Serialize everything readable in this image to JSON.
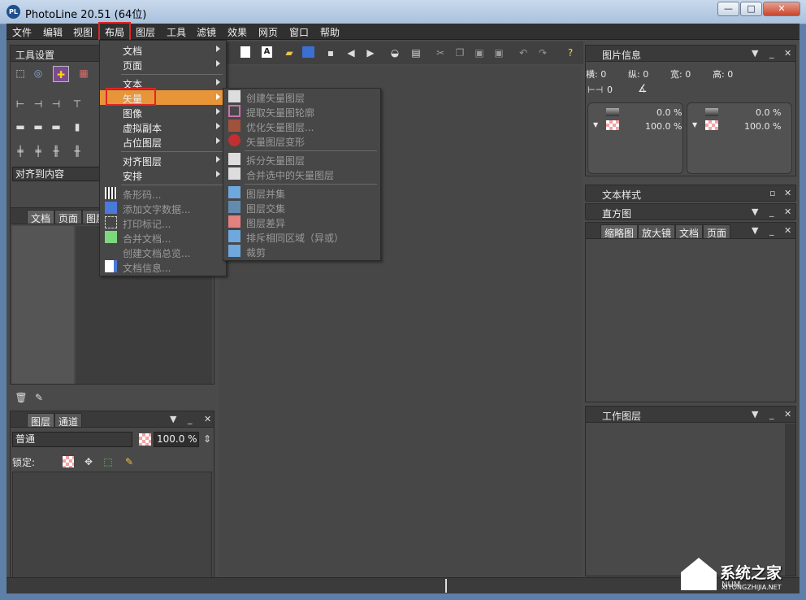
{
  "window": {
    "title": "PhotoLine 20.51 (64位)",
    "app_icon": "PL",
    "minimize": "—",
    "maximize": "□",
    "close": "✕"
  },
  "menubar": [
    "文件",
    "编辑",
    "视图",
    "布局",
    "图层",
    "工具",
    "滤镜",
    "效果",
    "网页",
    "窗口",
    "帮助"
  ],
  "tools_panel": {
    "title": "工具设置",
    "align_select": "对齐到内容"
  },
  "doc_panel": {
    "tabs": [
      "文档",
      "页面",
      "图层"
    ]
  },
  "layer_panel": {
    "tabs": [
      "图层",
      "通道"
    ],
    "blend_mode": "普通",
    "opacity": "100.0 %",
    "lock_label": "锁定:"
  },
  "info_panel": {
    "title": "图片信息",
    "x": "横: 0",
    "y": "纵: 0",
    "w": "宽: 0",
    "h": "高: 0",
    "dist": "0",
    "op1": "0.0 %",
    "op2": "100.0 %",
    "op3": "0.0 %",
    "op4": "100.0 %"
  },
  "text_style_panel": {
    "title": "文本样式"
  },
  "histogram_panel": {
    "title": "直方图"
  },
  "thumb_panel": {
    "tabs": [
      "缩略图",
      "放大镜",
      "文档",
      "页面"
    ]
  },
  "work_layer_panel": {
    "title": "工作图层"
  },
  "layout_menu": {
    "items": [
      {
        "label": "文档",
        "submenu": true
      },
      {
        "label": "页面",
        "submenu": true
      },
      {
        "label": "文本",
        "submenu": true
      },
      {
        "label": "矢量",
        "submenu": true,
        "highlighted": true
      },
      {
        "label": "图像",
        "submenu": true
      },
      {
        "label": "虚拟副本",
        "submenu": true
      },
      {
        "label": "占位图层",
        "submenu": true
      },
      {
        "label": "对齐图层",
        "submenu": true
      },
      {
        "label": "安排",
        "submenu": true
      },
      {
        "label": "条形码...",
        "disabled": true
      },
      {
        "label": "添加文字数据...",
        "disabled": true
      },
      {
        "label": "打印标记...",
        "disabled": true
      },
      {
        "label": "合并文档...",
        "disabled": true
      },
      {
        "label": "创建文档总览...",
        "disabled": true
      },
      {
        "label": "文档信息...",
        "disabled": true
      }
    ]
  },
  "vector_submenu": {
    "items": [
      "创建矢量图层",
      "提取矢量图轮廓",
      "优化矢量图层...",
      "矢量图层变形",
      "拆分矢量图层",
      "合并选中的矢量图层",
      "图层并集",
      "图层交集",
      "图层差异",
      "排斥相同区域（异或）",
      "裁剪"
    ]
  },
  "watermark": {
    "text": "系统之家",
    "sub": "XITONGZHIJIA.NET",
    "num": "NUM"
  },
  "colors": {
    "highlight": "#e8953a",
    "red_box": "#e02525"
  }
}
